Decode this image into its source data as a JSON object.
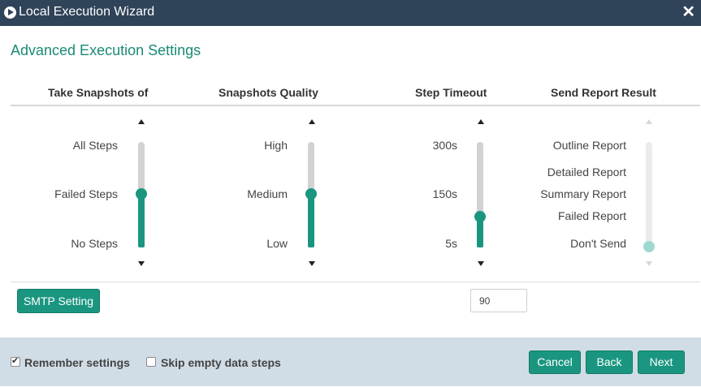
{
  "window": {
    "title": "Local Execution Wizard"
  },
  "heading": "Advanced Execution Settings",
  "columns": {
    "snapshots": {
      "header": "Take Snapshots of",
      "options": [
        "All Steps",
        "Failed Steps",
        "No Steps"
      ],
      "selected": "Failed Steps"
    },
    "quality": {
      "header": "Snapshots Quality",
      "options": [
        "High",
        "Medium",
        "Low"
      ],
      "selected": "Medium"
    },
    "timeout": {
      "header": "Step Timeout",
      "options": [
        "300s",
        "150s",
        "5s"
      ],
      "value": "90"
    },
    "report": {
      "header": "Send Report Result",
      "options": [
        "Outline Report",
        "Detailed Report",
        "Summary Report",
        "Failed Report",
        "Don't Send"
      ],
      "selected": "Don't Send",
      "disabled": true
    }
  },
  "smtp_button": "SMTP Setting",
  "footer": {
    "remember": {
      "label": "Remember settings",
      "checked": true
    },
    "skip_empty": {
      "label": "Skip empty data steps",
      "checked": false
    },
    "buttons": {
      "cancel": "Cancel",
      "back": "Back",
      "next": "Next"
    }
  },
  "colors": {
    "titlebar": "#2f4359",
    "accent": "#1a9680",
    "heading": "#1a8a77",
    "footer": "#d1dde6"
  },
  "icons": {
    "title": "play-circle-icon",
    "close": "close-icon"
  }
}
